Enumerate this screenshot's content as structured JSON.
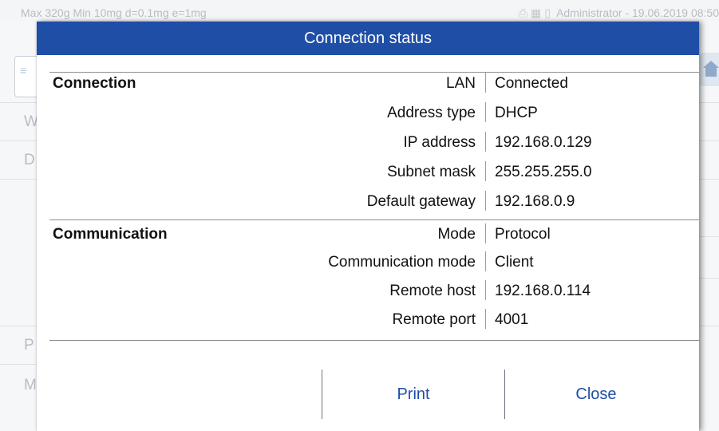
{
  "status_bar": {
    "scale_info": "Max 320g  Min 10mg  d=0.1mg  e=1mg",
    "user": "Administrator",
    "separator": "-",
    "datetime": "19.06.2019 08:50"
  },
  "background": {
    "letters": [
      "W",
      "D",
      "P",
      "M"
    ]
  },
  "dialog": {
    "title": "Connection status",
    "sections": [
      {
        "title": "Connection",
        "rows": [
          {
            "label": "LAN",
            "value": "Connected"
          },
          {
            "label": "Address type",
            "value": "DHCP"
          },
          {
            "label": "IP address",
            "value": "192.168.0.129"
          },
          {
            "label": "Subnet mask",
            "value": "255.255.255.0"
          },
          {
            "label": "Default gateway",
            "value": "192.168.0.9"
          }
        ]
      },
      {
        "title": "Communication",
        "rows": [
          {
            "label": "Mode",
            "value": "Protocol"
          },
          {
            "label": "Communication mode",
            "value": "Client"
          },
          {
            "label": "Remote host",
            "value": "192.168.0.114"
          },
          {
            "label": "Remote port",
            "value": "4001"
          }
        ]
      }
    ],
    "buttons": {
      "print": "Print",
      "close": "Close"
    }
  },
  "colors": {
    "header_bg": "#1f4ea6",
    "button_text": "#1f4ea6",
    "status_text": "#b9bcc3"
  }
}
